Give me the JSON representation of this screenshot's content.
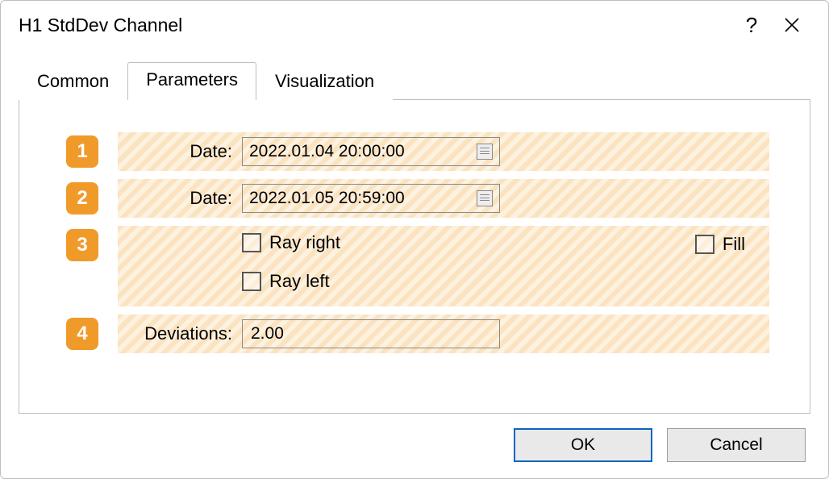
{
  "window": {
    "title": "H1 StdDev Channel"
  },
  "tabs": {
    "common": "Common",
    "parameters": "Parameters",
    "visualization": "Visualization",
    "active": "parameters"
  },
  "rows": {
    "r1": {
      "num": "1",
      "label": "Date:",
      "value": "2022.01.04 20:00:00"
    },
    "r2": {
      "num": "2",
      "label": "Date:",
      "value": "2022.01.05 20:59:00"
    },
    "r3": {
      "num": "3",
      "ray_right_label": "Ray right",
      "ray_left_label": "Ray left",
      "fill_label": "Fill"
    },
    "r4": {
      "num": "4",
      "label": "Deviations:",
      "value": "2.00"
    }
  },
  "buttons": {
    "ok": "OK",
    "cancel": "Cancel"
  }
}
